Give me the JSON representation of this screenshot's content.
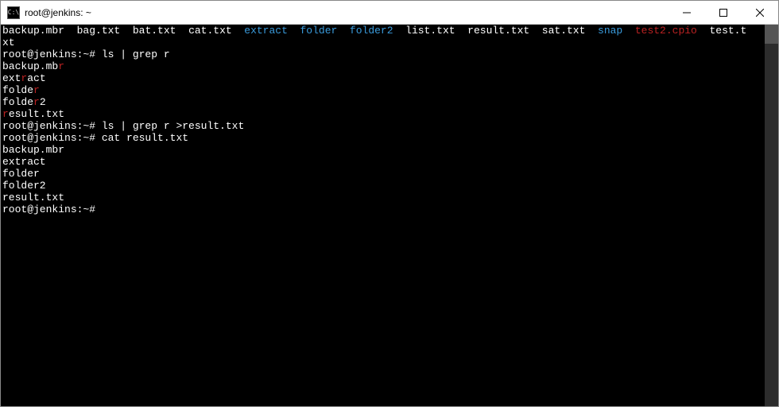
{
  "window": {
    "title": "root@jenkins: ~",
    "icon_label": "C:\\"
  },
  "controls": {
    "min_tip": "Minimize",
    "max_tip": "Maximize",
    "close_tip": "Close"
  },
  "prompt": {
    "user_host": "root@jenkins",
    "cwd": "~",
    "sep": ":",
    "end": "#"
  },
  "ls_files": [
    {
      "name": "backup.mbr",
      "style": "wh"
    },
    {
      "name": "bag.txt",
      "style": "wh"
    },
    {
      "name": "bat.txt",
      "style": "wh"
    },
    {
      "name": "cat.txt",
      "style": "wh"
    },
    {
      "name": "extract",
      "style": "cy"
    },
    {
      "name": "folder",
      "style": "cy"
    },
    {
      "name": "folder2",
      "style": "cy"
    },
    {
      "name": "list.txt",
      "style": "wh"
    },
    {
      "name": "result.txt",
      "style": "wh"
    },
    {
      "name": "sat.txt",
      "style": "wh"
    },
    {
      "name": "snap",
      "style": "cy"
    },
    {
      "name": "test2.cpio",
      "style": "rd"
    },
    {
      "name": "test.txt",
      "style": "wh"
    }
  ],
  "commands": {
    "cmd1": "ls | grep r",
    "cmd2": "ls | grep r >result.txt",
    "cmd3": "cat result.txt"
  },
  "grep_results": [
    {
      "pre": "backup.mb",
      "match": "r",
      "post": ""
    },
    {
      "pre": "ext",
      "match": "r",
      "post": "act"
    },
    {
      "pre": "folde",
      "match": "r",
      "post": ""
    },
    {
      "pre": "folde",
      "match": "r",
      "post": "2"
    },
    {
      "pre": "",
      "match": "r",
      "post": "esult.txt"
    }
  ],
  "cat_output": [
    "backup.mbr",
    "extract",
    "folder",
    "folder2",
    "result.txt"
  ]
}
